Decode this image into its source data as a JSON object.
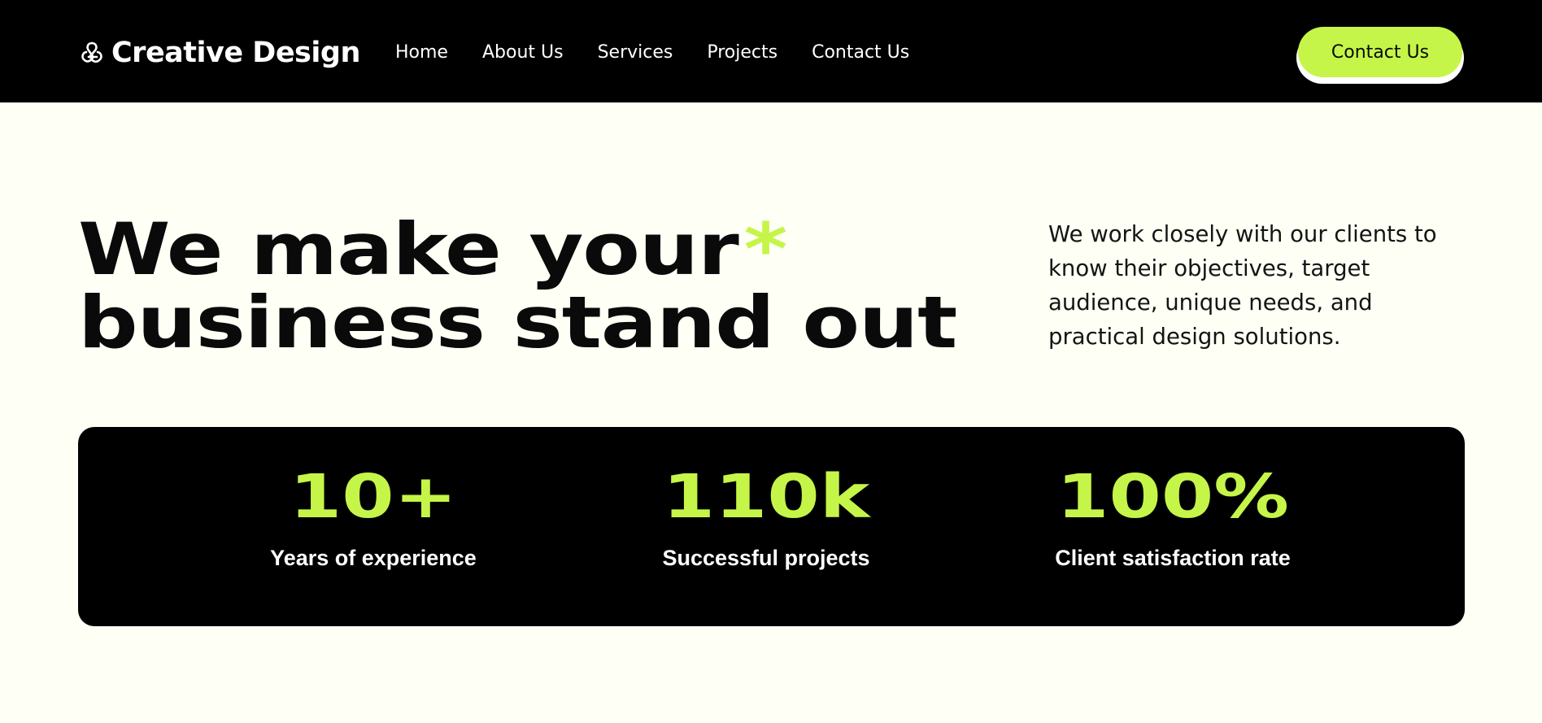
{
  "header": {
    "brand": {
      "icon": "knot-logo-icon",
      "name": "Creative Design"
    },
    "nav": [
      {
        "label": "Home"
      },
      {
        "label": "About Us"
      },
      {
        "label": "Services"
      },
      {
        "label": "Projects"
      },
      {
        "label": "Contact Us"
      }
    ],
    "cta_label": "Contact Us"
  },
  "hero": {
    "title_line1": "We make your",
    "title_decoration": "*",
    "title_line2": "business stand out",
    "description": "We work closely with our clients to know their objectives, target audience, unique needs, and practical design solutions."
  },
  "stats": [
    {
      "value": "10+",
      "label": "Years of experience"
    },
    {
      "value": "110k",
      "label": "Successful projects"
    },
    {
      "value": "100%",
      "label": "Client satisfaction rate"
    }
  ],
  "colors": {
    "accent": "#c5f548",
    "background": "#fefff5",
    "dark": "#000000",
    "text_on_dark": "#ffffff"
  }
}
